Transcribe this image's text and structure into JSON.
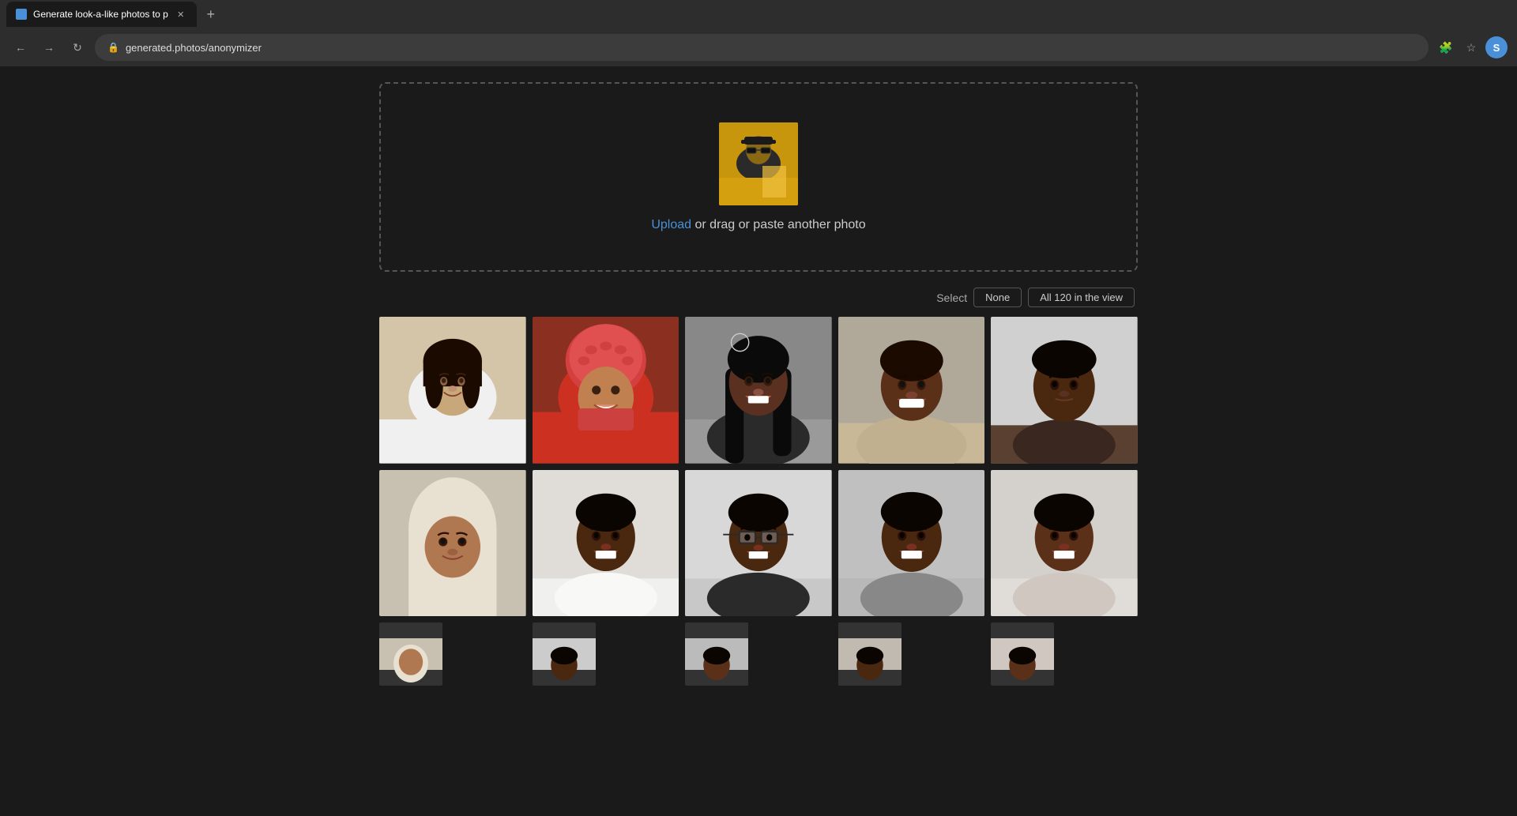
{
  "browser": {
    "tab_title": "Generate look-a-like photos to p",
    "tab_favicon": "🔵",
    "url": "generated.photos/anonymizer",
    "new_tab_label": "+",
    "back_title": "Back",
    "forward_title": "Forward",
    "refresh_title": "Refresh",
    "profile_letter": "S"
  },
  "upload": {
    "link_text": "Upload",
    "description": " or drag or paste another photo"
  },
  "gallery": {
    "select_label": "Select",
    "none_button": "None",
    "all_button": "All 120 in the view",
    "photo_count": 120
  },
  "photos": [
    {
      "id": 1,
      "alt": "Young girl smiling",
      "skin": "light-brown",
      "row": 1
    },
    {
      "id": 2,
      "alt": "Woman with red head covering",
      "skin": "medium-brown",
      "row": 1
    },
    {
      "id": 3,
      "alt": "Young woman smiling",
      "skin": "dark",
      "row": 1
    },
    {
      "id": 4,
      "alt": "Person smiling",
      "skin": "dark",
      "row": 1
    },
    {
      "id": 5,
      "alt": "Person neutral expression",
      "skin": "dark",
      "row": 1
    },
    {
      "id": 6,
      "alt": "Woman with head covering",
      "skin": "medium",
      "row": 2
    },
    {
      "id": 7,
      "alt": "Woman smiling",
      "skin": "dark",
      "row": 2
    },
    {
      "id": 8,
      "alt": "Woman with glasses",
      "skin": "dark",
      "row": 2
    },
    {
      "id": 9,
      "alt": "Person smiling",
      "skin": "dark",
      "row": 2
    },
    {
      "id": 10,
      "alt": "Woman smiling",
      "skin": "dark",
      "row": 2
    }
  ]
}
